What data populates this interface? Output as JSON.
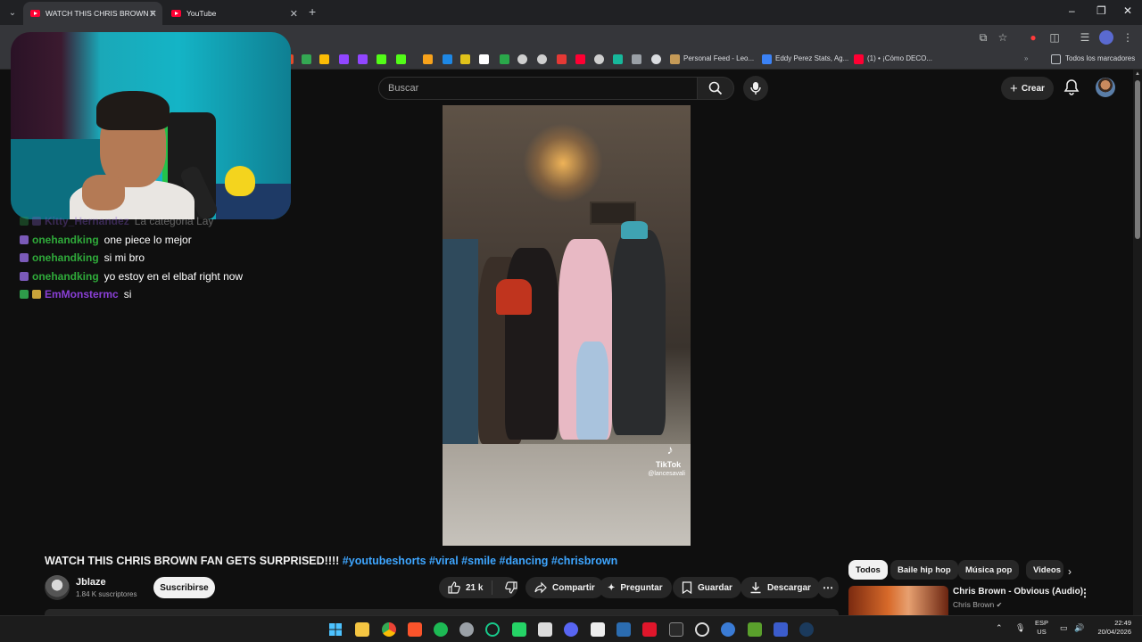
{
  "browser": {
    "tabs": [
      {
        "title": "WATCH THIS CHRIS BROWN FAN",
        "active": true
      },
      {
        "title": "YouTube",
        "active": false
      }
    ],
    "bookmarks": [
      {
        "label": "Personal Feed - Leo..."
      },
      {
        "label": "Eddy Perez Stats, Ag..."
      },
      {
        "label": "(1) • ¡Cómo DECO..."
      },
      {
        "label": "Todos los marcadores"
      }
    ]
  },
  "youtube": {
    "search_placeholder": "Buscar",
    "create_label": "Crear"
  },
  "chat": [
    {
      "user": "Kitty_Hernandez",
      "message": "La categoria Lay",
      "user_color": "#8a5bd6",
      "badge": "check"
    },
    {
      "user": "onehandking",
      "message": "one piece lo mejor",
      "user_color": "#2faa3a",
      "badge": "sub"
    },
    {
      "user": "onehandking",
      "message": "si mi bro",
      "user_color": "#2faa3a",
      "badge": "sub"
    },
    {
      "user": "onehandking",
      "message": "yo estoy en el elbaf right now",
      "user_color": "#2faa3a",
      "badge": "sub"
    },
    {
      "user": "EmMonstermc",
      "message": "si",
      "user_color": "#8a3fd6",
      "badge": "check"
    }
  ],
  "video": {
    "watermark": "TikTok",
    "watermark_user": "@lancesavali",
    "title": "WATCH THIS CHRIS BROWN FAN GETS SURPRISED!!!! ",
    "hashtags": "#youtubeshorts #viral #smile #dancing #chrisbrown",
    "channel_name": "Jblaze",
    "channel_subs": "1.84 K suscriptores",
    "subscribe_label": "Suscribirse",
    "likes": "21 k",
    "share_label": "Compartir",
    "ask_label": "Preguntar",
    "save_label": "Guardar",
    "download_label": "Descargar"
  },
  "sidebar": {
    "chips": [
      "Todos",
      "Baile hip hop",
      "Música pop",
      "Videos"
    ],
    "related": [
      {
        "title": "Chris Brown - Obvious (Audio)",
        "channel": "Chris Brown"
      }
    ]
  },
  "taskbar": {
    "lang_line1": "ESP",
    "lang_line2": "US",
    "time": "22:49",
    "date": "20/04/2026"
  },
  "colors": {
    "youtube_red": "#ff0033",
    "link_blue": "#3ea6ff",
    "background": "#0f0f0f"
  }
}
